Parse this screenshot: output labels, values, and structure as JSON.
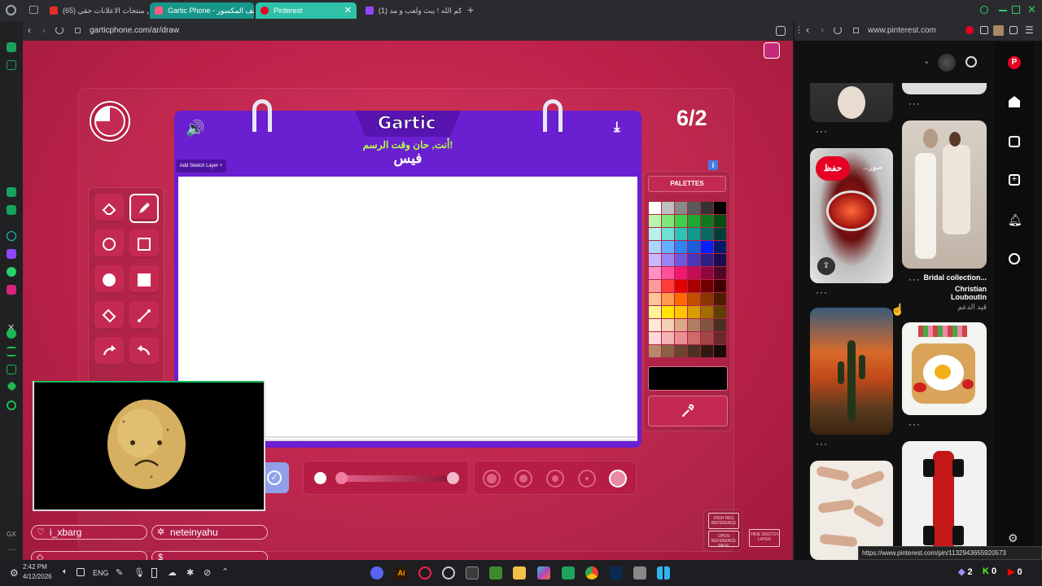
{
  "tabs": [
    {
      "label": "(65) هل منتجات الاعلانات حقي...",
      "color": "#e52d27",
      "active": false
    },
    {
      "label": "Gartic Phone - الهاتف المكسور",
      "color": "#ff5a82",
      "active": false
    },
    {
      "label": "Pinterest",
      "color": "#e60023",
      "active": true
    },
    {
      "label": "(1) حياكم الله ! يبث ولعب و مد...",
      "color": "#9146ff",
      "active": false
    }
  ],
  "new_tab": "+",
  "main_url": "garticphone.com/ar/draw",
  "side_url": "www.pinterest.com",
  "game": {
    "logo": "Gartic",
    "instruction": "أنت, حان وقت الرسم!",
    "word": "فيس",
    "round": "6/2",
    "add_layer": "Add Sketch Layer +",
    "palettes_label": "PALETTES",
    "info": "i",
    "corner_buttons": [
      "HIGH RES REFERENCE",
      "OPEN REFERENCE PAGE",
      "HIDE SKETCH LAYER"
    ]
  },
  "palette": [
    [
      "#ffffff",
      "#c0c0c0",
      "#8a8a8a",
      "#5a5a5a",
      "#333333",
      "#000000"
    ],
    [
      "#b8f5b0",
      "#7ee87a",
      "#3ed14a",
      "#1fa833",
      "#0d7a1f",
      "#064d13"
    ],
    [
      "#b6f2ea",
      "#6fe0d4",
      "#2cc4b6",
      "#129a8d",
      "#0a6b62",
      "#033f3a"
    ],
    [
      "#a9d6ff",
      "#62b0ff",
      "#2d86f2",
      "#1a5fd4",
      "#0020ff",
      "#061a6a"
    ],
    [
      "#c9b8ff",
      "#9a85f5",
      "#6f58e0",
      "#4a36b8",
      "#2c1f85",
      "#170f4f"
    ],
    [
      "#ff8fc7",
      "#ff4f9a",
      "#f01870",
      "#c40d55",
      "#8e0a3e",
      "#520624"
    ],
    [
      "#ff9a9a",
      "#ff3b3b",
      "#e10000",
      "#a80000",
      "#700000",
      "#3e0000"
    ],
    [
      "#ffc59a",
      "#ff9a4f",
      "#ff6a00",
      "#c24f00",
      "#8a3600",
      "#4a1d00"
    ],
    [
      "#fff49a",
      "#ffe500",
      "#ffc400",
      "#d89c00",
      "#9e7000",
      "#5c4000"
    ],
    [
      "#ffe8d6",
      "#f4cfb2",
      "#d9a98a",
      "#b07f62",
      "#7f5640",
      "#4a2f22"
    ],
    [
      "#ffd9d9",
      "#f2b4b4",
      "#e89090",
      "#d06a6a",
      "#a34646",
      "#6b2a2a"
    ],
    [
      "#b58a6a",
      "#8c6244",
      "#6a4530",
      "#4b2f20",
      "#2f1b12",
      "#170c07"
    ]
  ],
  "players": [
    {
      "name": "i_xbarg",
      "icon": "heart"
    },
    {
      "name": "neteinyahu",
      "icon": "star"
    },
    {
      "name": "",
      "icon": "diamond"
    },
    {
      "name": "",
      "icon": "dollar"
    }
  ],
  "pinterest": {
    "save_button": "حفظ",
    "more_label": "...صور",
    "board_title": "Bridal collection...",
    "board_subtitle": "Christian Louboutin",
    "board_meta": "قيد الدعم",
    "status_url": "https://www.pinterest.com/pin/1132943655920573"
  },
  "taskbar": {
    "time": "2:42 PM",
    "date": "4/12/2026",
    "language": "ENG",
    "badges": [
      "2",
      "0",
      "0"
    ]
  },
  "colors": {
    "accent_purple": "#6a1fd0",
    "page_red": "#c8244f",
    "pinterest_red": "#e60023"
  }
}
